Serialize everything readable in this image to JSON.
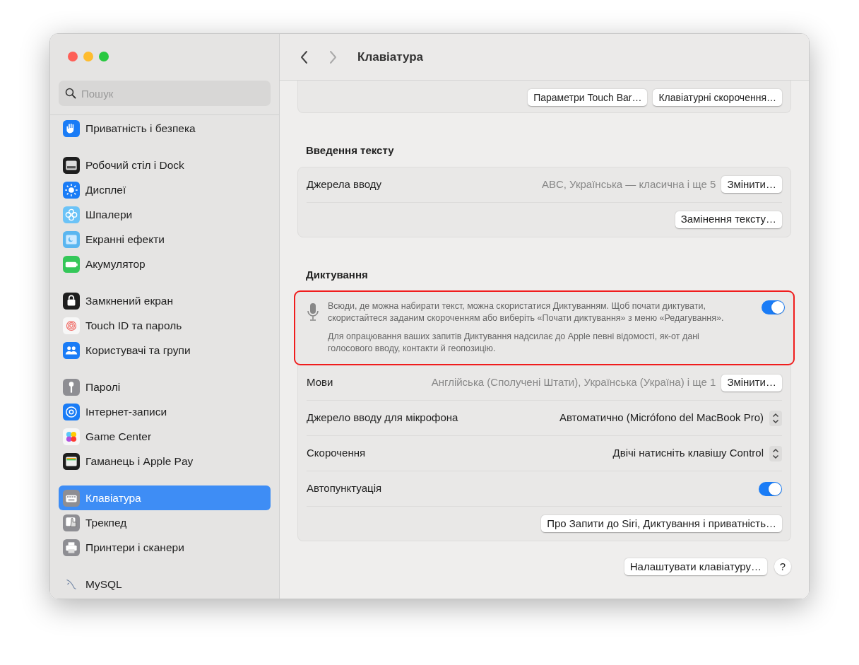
{
  "window": {
    "title": "Клавіатура"
  },
  "sidebar": {
    "search": {
      "placeholder": "Пошук"
    },
    "groups": [
      [
        {
          "label": "Приватність і безпека",
          "selected": false
        }
      ],
      [
        {
          "label": "Робочий стіл і Dock",
          "selected": false
        },
        {
          "label": "Дисплеї",
          "selected": false
        },
        {
          "label": "Шпалери",
          "selected": false
        },
        {
          "label": "Екранні ефекти",
          "selected": false
        },
        {
          "label": "Акумулятор",
          "selected": false
        }
      ],
      [
        {
          "label": "Замкнений екран",
          "selected": false
        },
        {
          "label": "Touch ID та пароль",
          "selected": false
        },
        {
          "label": "Користувачі та групи",
          "selected": false
        }
      ],
      [
        {
          "label": "Паролі",
          "selected": false
        },
        {
          "label": "Інтернет-записи",
          "selected": false
        },
        {
          "label": "Game Center",
          "selected": false
        },
        {
          "label": "Гаманець і Apple Pay",
          "selected": false
        }
      ],
      [
        {
          "label": "Клавіатура",
          "selected": true
        },
        {
          "label": "Трекпед",
          "selected": false
        },
        {
          "label": "Принтери і сканери",
          "selected": false
        }
      ],
      [
        {
          "label": "MySQL",
          "selected": false
        }
      ]
    ]
  },
  "top_buttons": [
    "Параметри Touch Bar…",
    "Клавіатурні скорочення…"
  ],
  "sections": [
    {
      "title": "Введення тексту",
      "rows": [
        {
          "kind": "value_button",
          "label": "Джерела вводу",
          "value": "ABC, Українська — класична і ще 5",
          "button": "Змінити…"
        },
        {
          "kind": "button",
          "button": "Замінення тексту…"
        }
      ]
    },
    {
      "title": "Диктування",
      "dictation": {
        "text": "Всюди, де можна набирати текст, можна скористатися Диктуванням. Щоб почати диктувати, скористайтеся заданим скороченням або виберіть «Почати диктування» з меню «Редагування».",
        "note": "Для опрацювання ваших запитів Диктування надсилає до Apple певні відомості, як-от дані голосового вводу, контакти й геопозицію.",
        "on": true,
        "highlighted": true
      },
      "rows": [
        {
          "kind": "value_button",
          "label": "Мови",
          "value": "Англійська (Сполучені Штати), Українська (Україна) і ще 1",
          "button": "Змінити…"
        },
        {
          "kind": "popup",
          "label": "Джерело вводу для мікрофона",
          "value": "Автоматично (Micrófono del MacBook Pro)"
        },
        {
          "kind": "popup",
          "label": "Скорочення",
          "value": "Двічі натисніть клавішу Control"
        },
        {
          "kind": "toggle",
          "label": "Автопунктуація",
          "on": true
        },
        {
          "kind": "button",
          "button": "Про Запити до Siri, Диктування і приватність…"
        }
      ]
    }
  ],
  "footer": {
    "button": "Налаштувати клавіатуру…",
    "help": "?"
  }
}
